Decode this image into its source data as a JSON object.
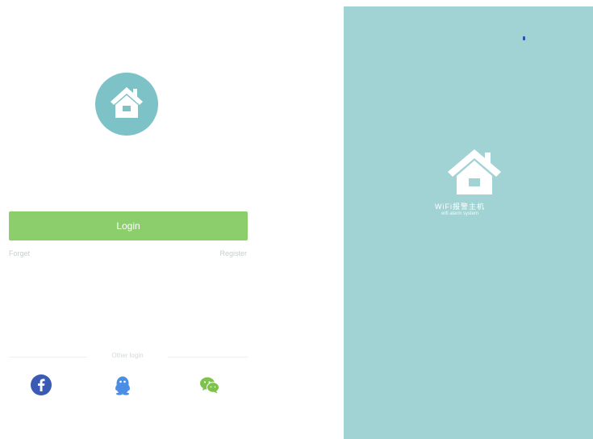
{
  "colors": {
    "logo_circle": "#7dc2c6",
    "login_button": "#8cce6c",
    "splash_background": "#a2d3d4",
    "facebook": "#3b5ab3",
    "qq": "#4a8ee6",
    "wechat": "#7dc24a"
  },
  "login": {
    "logo_icon": "house-icon",
    "login_label": "Login",
    "forget_label": "Forget",
    "register_label": "Register",
    "third_party_label": "Other login",
    "social_icons": [
      "facebook-icon",
      "qq-icon",
      "wechat-icon"
    ]
  },
  "splash": {
    "logo_icon": "house-icon",
    "title": "WiFi报警主机",
    "subtitle": "wifi alarm system"
  }
}
